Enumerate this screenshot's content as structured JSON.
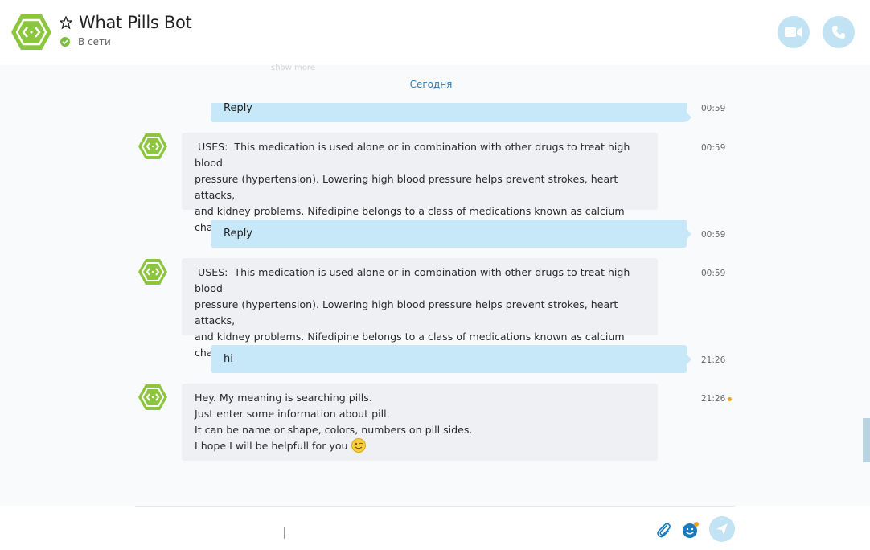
{
  "header": {
    "title": "What Pills Bot",
    "status": "В сети",
    "video_icon": "video-camera-icon",
    "call_icon": "phone-icon"
  },
  "chat": {
    "date_separator": "Сегодня",
    "faint_top_text": "show more",
    "messages": [
      {
        "type": "outgoing",
        "text": "Reply",
        "time": "00:59"
      },
      {
        "type": "incoming",
        "text": " USES:  This medication is used alone or in combination with other drugs to treat high blood\npressure (hypertension). Lowering high blood pressure helps prevent strokes, heart attacks,\nand kidney problems. Nifedipine belongs to a class of medications known as calcium\nchannel blockers. It works by relaxing blood vessels so blood can flow more easily.",
        "time": "00:59"
      },
      {
        "type": "outgoing",
        "text": "Reply",
        "time": "00:59"
      },
      {
        "type": "incoming",
        "text": " USES:  This medication is used alone or in combination with other drugs to treat high blood\npressure (hypertension). Lowering high blood pressure helps prevent strokes, heart attacks,\nand kidney problems. Nifedipine belongs to a class of medications known as calcium\nchannel blockers. It works by relaxing blood vessels so blood can flow more easily.",
        "time": "00:59"
      },
      {
        "type": "outgoing",
        "text": "hi",
        "time": "21:26"
      },
      {
        "type": "incoming",
        "lines": [
          "Hey. My meaning is searching pills.",
          "Just enter some information about pill.",
          "It can be name or shape, colors, numbers on pill sides.",
          "I hope I will be helpfull for you"
        ],
        "time": "21:26",
        "emoji": "wink-smiley-icon"
      }
    ]
  },
  "composer": {
    "placeholder": "",
    "value": ""
  },
  "colors": {
    "bot_green": "#8cc63f",
    "outgoing_bubble": "#c7e8f8",
    "incoming_bubble": "#eef0f4",
    "accent_blue": "#2a7db5",
    "unread": "#f0a020"
  }
}
